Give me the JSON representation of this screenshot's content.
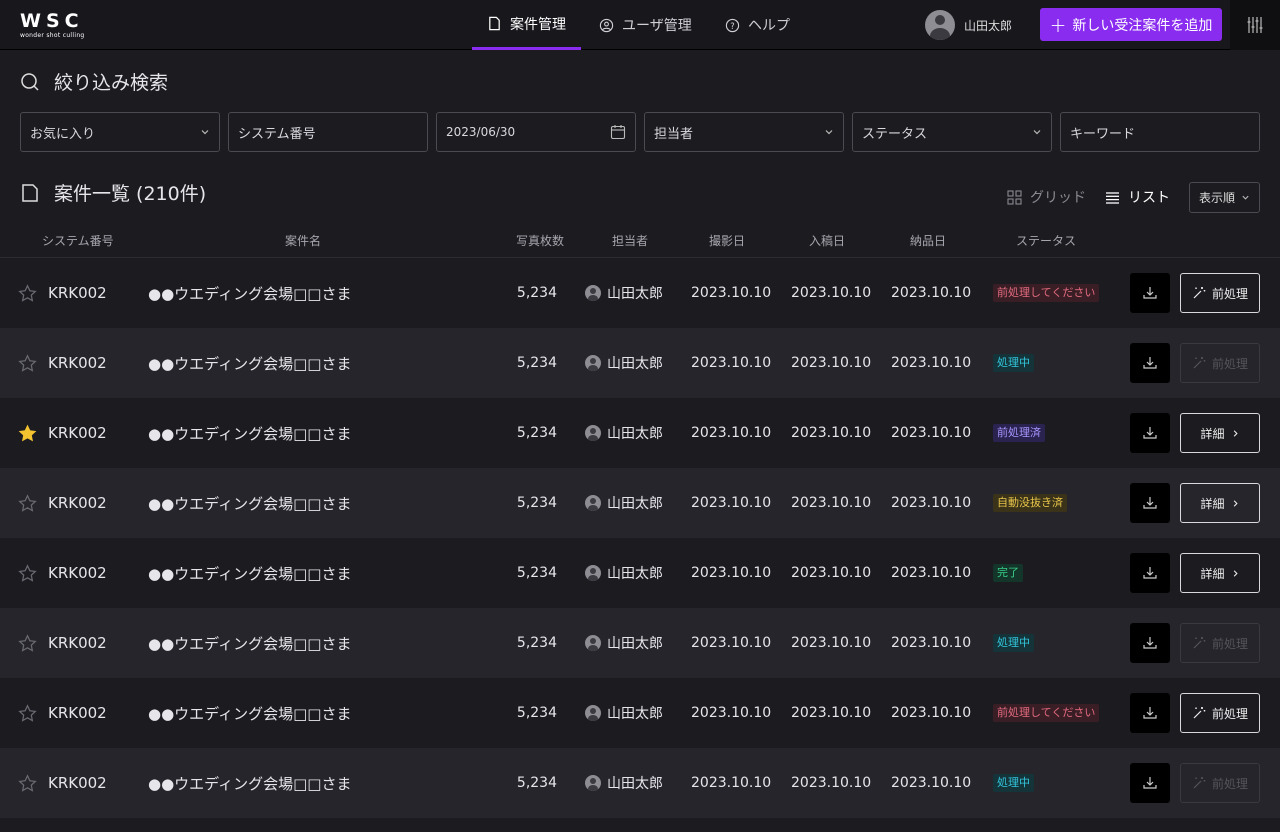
{
  "header": {
    "logo_main": "WSC",
    "logo_sub": "wonder shot culling",
    "tabs": [
      {
        "label": "案件管理",
        "icon": "document-icon",
        "active": true
      },
      {
        "label": "ユーザ管理",
        "icon": "user-circle-icon",
        "active": false
      },
      {
        "label": "ヘルプ",
        "icon": "help-circle-icon",
        "active": false
      }
    ],
    "user_name": "山田太郎",
    "add_button_label": "新しい受注案件を追加",
    "accent_color": "#8a2cf0"
  },
  "filter": {
    "title": "絞り込み検索",
    "fields": {
      "favorite": "お気に入り",
      "system_number": "システム番号",
      "date": "2023/06/30",
      "assignee": "担当者",
      "status": "ステータス",
      "keyword": "キーワード"
    }
  },
  "list": {
    "title": "案件一覧 (210件)",
    "view_grid": "グリッド",
    "view_list": "リスト",
    "sort_label": "表示順",
    "columns": [
      "システム番号",
      "案件名",
      "写真枚数",
      "担当者",
      "撮影日",
      "入稿日",
      "納品日",
      "ステータス"
    ],
    "rows": [
      {
        "starred": false,
        "id": "KRK002",
        "name": "●●ウエディング会場□□さま",
        "count": "5,234",
        "assignee": "山田太郎",
        "shoot": "2023.10.10",
        "submit": "2023.10.10",
        "deliver": "2023.10.10",
        "status": "前処理してください",
        "status_color": "red",
        "action": "前処理",
        "action_icon": "magic-wand-icon",
        "action_enabled": true
      },
      {
        "starred": false,
        "id": "KRK002",
        "name": "●●ウエディング会場□□さま",
        "count": "5,234",
        "assignee": "山田太郎",
        "shoot": "2023.10.10",
        "submit": "2023.10.10",
        "deliver": "2023.10.10",
        "status": "処理中",
        "status_color": "cyan",
        "action": "前処理",
        "action_icon": "magic-wand-icon",
        "action_enabled": false
      },
      {
        "starred": true,
        "id": "KRK002",
        "name": "●●ウエディング会場□□さま",
        "count": "5,234",
        "assignee": "山田太郎",
        "shoot": "2023.10.10",
        "submit": "2023.10.10",
        "deliver": "2023.10.10",
        "status": "前処理済",
        "status_color": "purple",
        "action": "詳細",
        "action_icon": "chevron-right-icon",
        "action_enabled": true
      },
      {
        "starred": false,
        "id": "KRK002",
        "name": "●●ウエディング会場□□さま",
        "count": "5,234",
        "assignee": "山田太郎",
        "shoot": "2023.10.10",
        "submit": "2023.10.10",
        "deliver": "2023.10.10",
        "status": "自動没抜き済",
        "status_color": "yellow",
        "action": "詳細",
        "action_icon": "chevron-right-icon",
        "action_enabled": true
      },
      {
        "starred": false,
        "id": "KRK002",
        "name": "●●ウエディング会場□□さま",
        "count": "5,234",
        "assignee": "山田太郎",
        "shoot": "2023.10.10",
        "submit": "2023.10.10",
        "deliver": "2023.10.10",
        "status": "完了",
        "status_color": "green",
        "action": "詳細",
        "action_icon": "chevron-right-icon",
        "action_enabled": true
      },
      {
        "starred": false,
        "id": "KRK002",
        "name": "●●ウエディング会場□□さま",
        "count": "5,234",
        "assignee": "山田太郎",
        "shoot": "2023.10.10",
        "submit": "2023.10.10",
        "deliver": "2023.10.10",
        "status": "処理中",
        "status_color": "cyan",
        "action": "前処理",
        "action_icon": "magic-wand-icon",
        "action_enabled": false
      },
      {
        "starred": false,
        "id": "KRK002",
        "name": "●●ウエディング会場□□さま",
        "count": "5,234",
        "assignee": "山田太郎",
        "shoot": "2023.10.10",
        "submit": "2023.10.10",
        "deliver": "2023.10.10",
        "status": "前処理してください",
        "status_color": "red",
        "action": "前処理",
        "action_icon": "magic-wand-icon",
        "action_enabled": true
      },
      {
        "starred": false,
        "id": "KRK002",
        "name": "●●ウエディング会場□□さま",
        "count": "5,234",
        "assignee": "山田太郎",
        "shoot": "2023.10.10",
        "submit": "2023.10.10",
        "deliver": "2023.10.10",
        "status": "処理中",
        "status_color": "cyan",
        "action": "前処理",
        "action_icon": "magic-wand-icon",
        "action_enabled": false
      }
    ]
  }
}
